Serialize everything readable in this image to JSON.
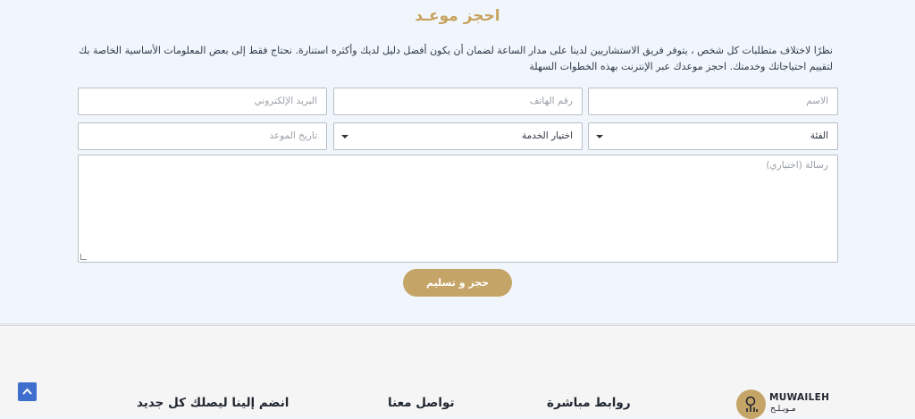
{
  "booking": {
    "title": "احجز موعـد",
    "intro": "نظرًا لاختلاف متطلبات كل شخص ، يتوفر فريق الاستشاريين لدينا على مدار الساعة لضمان أن يكون أفضل دليل لديك وأكثره استنارة. نحتاج فقط إلى بعض المعلومات الأساسية الخاصة بك لتقييم احتياجاتك وخدمتك. احجز موعدك عبر الإنترنت بهذه الخطوات السهلة",
    "fields": {
      "name_placeholder": "الاسم",
      "phone_placeholder": "رقم الهاتف",
      "email_placeholder": "البريد الإلكتروني",
      "category_selected": "الفئة",
      "service_selected": "اختيار الخدمة",
      "date_placeholder": "تاريخ الموعد",
      "message_placeholder": "رسالة (اختياري)"
    },
    "submit_label": "حجز و تسليم"
  },
  "footer": {
    "logo_name": "MUWAILEH",
    "logo_sub": "مـويـلـح",
    "quick_links_heading": "روابط مباشرة",
    "contact_heading": "تواصل معنا",
    "newsletter_heading": "انضم إلينا ليصلك كل جديد"
  },
  "colors": {
    "accent_gold": "#c5a467",
    "page_bg": "#f1f6fd",
    "scroll_button": "#3f6fce"
  }
}
